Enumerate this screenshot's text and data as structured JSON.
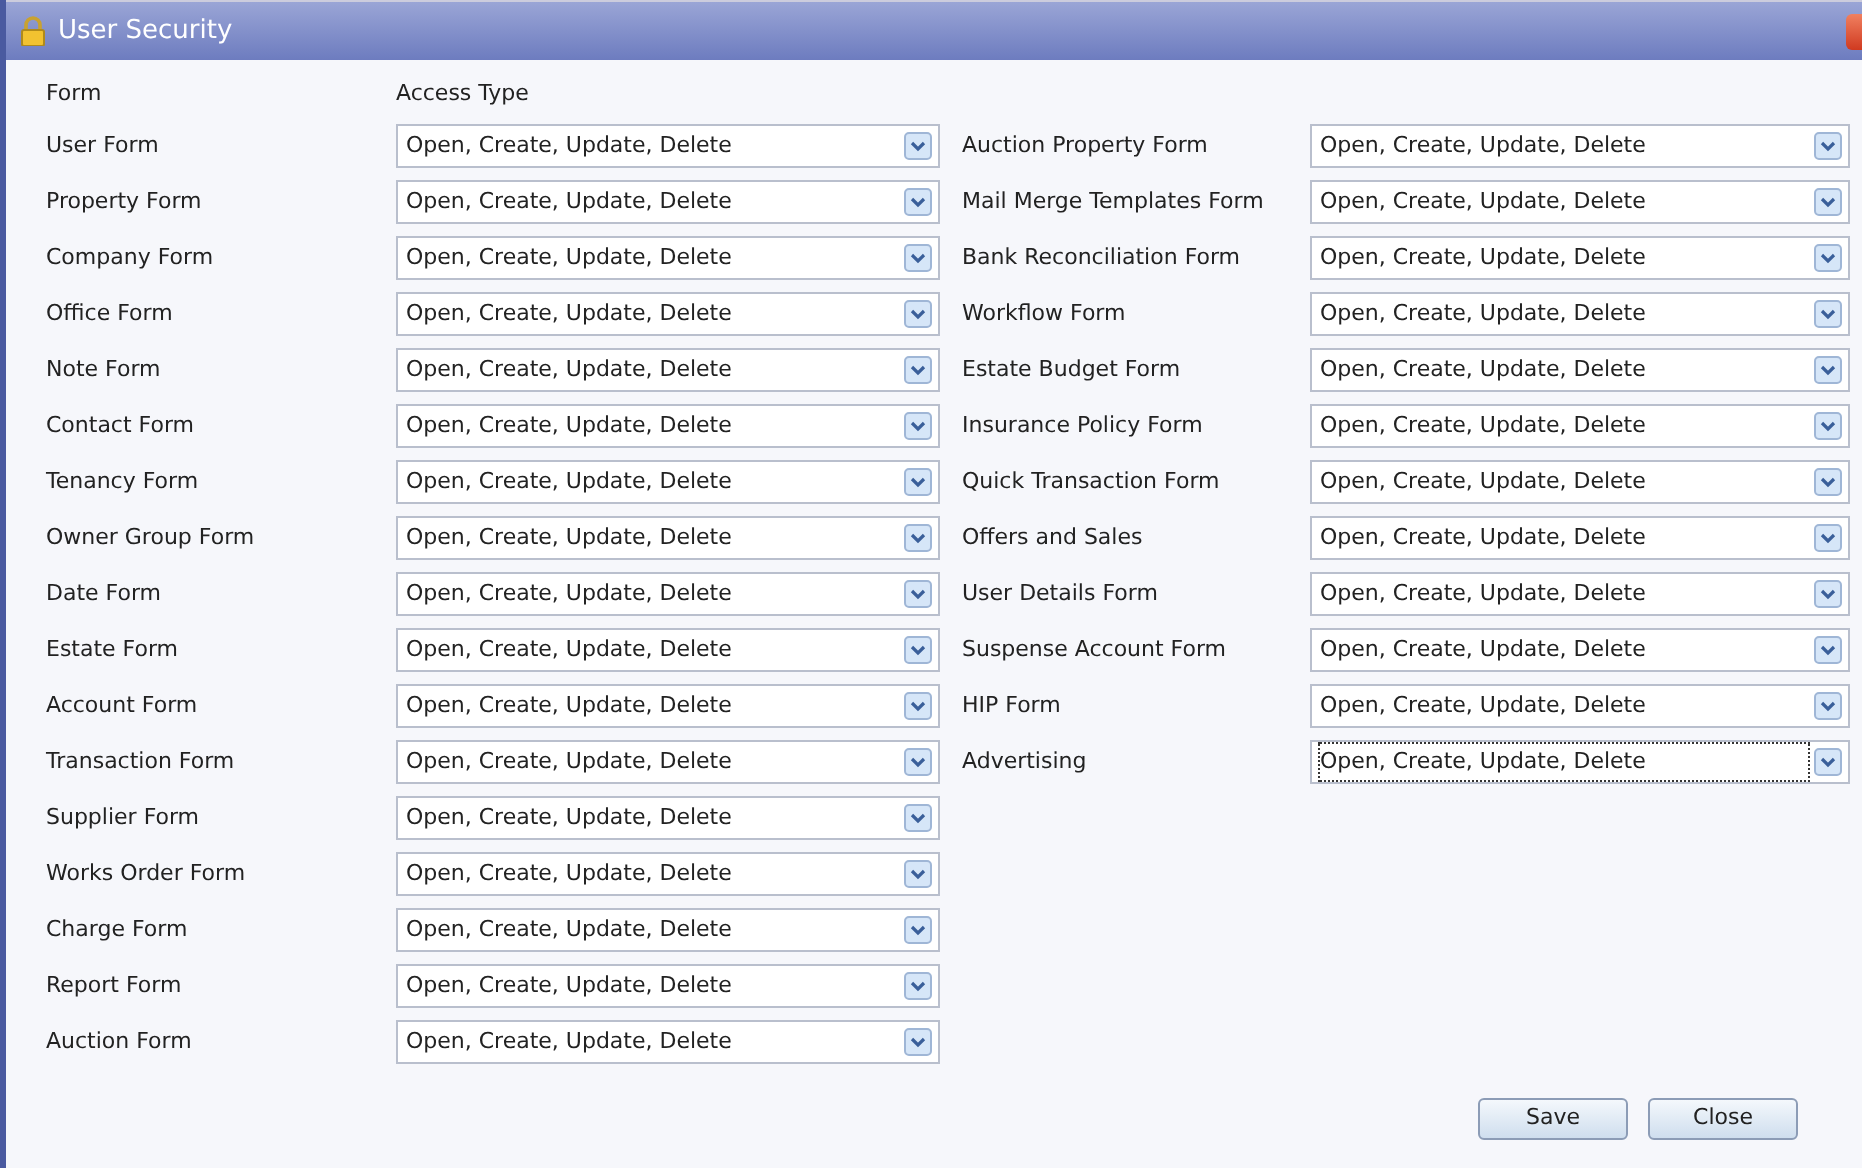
{
  "window": {
    "title": "User Security"
  },
  "headers": {
    "form": "Form",
    "access_type": "Access Type"
  },
  "left_rows": [
    {
      "form": "User Form",
      "access": "Open, Create, Update, Delete",
      "focused": false
    },
    {
      "form": "Property Form",
      "access": "Open, Create, Update, Delete",
      "focused": false
    },
    {
      "form": "Company Form",
      "access": "Open, Create, Update, Delete",
      "focused": false
    },
    {
      "form": "Office Form",
      "access": "Open, Create, Update, Delete",
      "focused": false
    },
    {
      "form": "Note Form",
      "access": "Open, Create, Update, Delete",
      "focused": false
    },
    {
      "form": "Contact Form",
      "access": "Open, Create, Update, Delete",
      "focused": false
    },
    {
      "form": "Tenancy Form",
      "access": "Open, Create, Update, Delete",
      "focused": false
    },
    {
      "form": "Owner Group Form",
      "access": "Open, Create, Update, Delete",
      "focused": false
    },
    {
      "form": "Date Form",
      "access": "Open, Create, Update, Delete",
      "focused": false
    },
    {
      "form": "Estate Form",
      "access": "Open, Create, Update, Delete",
      "focused": false
    },
    {
      "form": "Account Form",
      "access": "Open, Create, Update, Delete",
      "focused": false
    },
    {
      "form": "Transaction Form",
      "access": "Open, Create, Update, Delete",
      "focused": false
    },
    {
      "form": "Supplier Form",
      "access": "Open, Create, Update, Delete",
      "focused": false
    },
    {
      "form": "Works Order Form",
      "access": "Open, Create, Update, Delete",
      "focused": false
    },
    {
      "form": "Charge Form",
      "access": "Open, Create, Update, Delete",
      "focused": false
    },
    {
      "form": "Report Form",
      "access": "Open, Create, Update, Delete",
      "focused": false
    },
    {
      "form": "Auction Form",
      "access": "Open, Create, Update, Delete",
      "focused": false
    }
  ],
  "right_rows": [
    {
      "form": "Auction Property Form",
      "access": "Open, Create, Update, Delete",
      "focused": false
    },
    {
      "form": "Mail Merge Templates Form",
      "access": "Open, Create, Update, Delete",
      "focused": false
    },
    {
      "form": "Bank Reconciliation Form",
      "access": "Open, Create, Update, Delete",
      "focused": false
    },
    {
      "form": "Workflow Form",
      "access": "Open, Create, Update, Delete",
      "focused": false
    },
    {
      "form": "Estate Budget Form",
      "access": "Open, Create, Update, Delete",
      "focused": false
    },
    {
      "form": "Insurance Policy Form",
      "access": "Open, Create, Update, Delete",
      "focused": false
    },
    {
      "form": "Quick Transaction Form",
      "access": "Open, Create, Update, Delete",
      "focused": false
    },
    {
      "form": "Offers and Sales",
      "access": "Open, Create, Update, Delete",
      "focused": false
    },
    {
      "form": "User Details Form",
      "access": "Open, Create, Update, Delete",
      "focused": false
    },
    {
      "form": "Suspense Account Form",
      "access": "Open, Create, Update, Delete",
      "focused": false
    },
    {
      "form": "HIP Form",
      "access": "Open, Create, Update, Delete",
      "focused": false
    },
    {
      "form": "Advertising",
      "access": "Open, Create, Update, Delete",
      "focused": true
    }
  ],
  "buttons": [
    "Save",
    "Close"
  ]
}
